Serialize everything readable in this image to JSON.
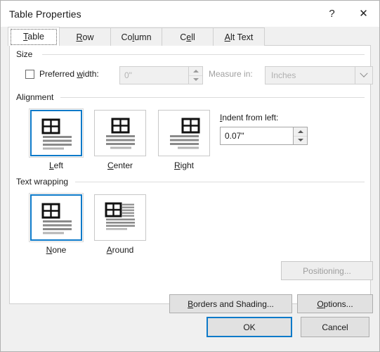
{
  "window": {
    "title": "Table Properties",
    "help_label": "?",
    "close_label": "✕"
  },
  "tabs": [
    {
      "label": "Table",
      "accel_before": "T",
      "accel_rest": "able",
      "active": true
    },
    {
      "label": "Row",
      "accel_before": "R",
      "accel_rest": "ow",
      "active": false
    },
    {
      "label": "Column",
      "accel_before": "Co",
      "accel_rest": "umn",
      "active": false
    },
    {
      "label": "Cell",
      "accel_before": "C",
      "accel_rest": "ll",
      "active": false
    },
    {
      "label": "Alt Text",
      "accel_before": "A",
      "accel_rest": "lt Text",
      "active": false
    }
  ],
  "size": {
    "group_label": "Size",
    "preferred_width": {
      "label_a": "Preferred ",
      "label_accel": "w",
      "label_b": "idth:",
      "checked": false,
      "value": "0\"",
      "enabled": false
    },
    "measure_in": {
      "label": "Measure in:",
      "value": "Inches",
      "enabled": false
    }
  },
  "alignment": {
    "group_label": "Alignment",
    "options": [
      {
        "caption_accel": "L",
        "caption_rest": "eft",
        "icon": "align-left-icon",
        "selected": true
      },
      {
        "caption_accel": "C",
        "caption_rest": "enter",
        "icon": "align-center-icon",
        "selected": false
      },
      {
        "caption_accel": "R",
        "caption_rest": "ight",
        "icon": "align-right-icon",
        "selected": false
      }
    ],
    "indent": {
      "label_accel": "I",
      "label_rest": "ndent from left:",
      "value": "0.07\"",
      "enabled": true
    }
  },
  "text_wrapping": {
    "group_label": "Text wrapping",
    "options": [
      {
        "caption_accel": "N",
        "caption_rest": "one",
        "icon": "wrap-none-icon",
        "selected": true
      },
      {
        "caption_accel": "A",
        "caption_rest": "round",
        "icon": "wrap-around-icon",
        "selected": false
      }
    ]
  },
  "actions": {
    "positioning": {
      "label": "Positioning...",
      "enabled": false
    },
    "borders_and_shading": {
      "label_accel": "B",
      "label_rest": "orders and Shading...",
      "enabled": true
    },
    "options": {
      "label_accel": "O",
      "label_rest": "ptions...",
      "enabled": true
    }
  },
  "footer": {
    "ok": "OK",
    "cancel": "Cancel"
  },
  "colors": {
    "accent": "#0d7ac9",
    "dialog_bg": "#f0f0f0",
    "panel_bg": "#ffffff",
    "disabled_text": "#a0a0a0"
  }
}
